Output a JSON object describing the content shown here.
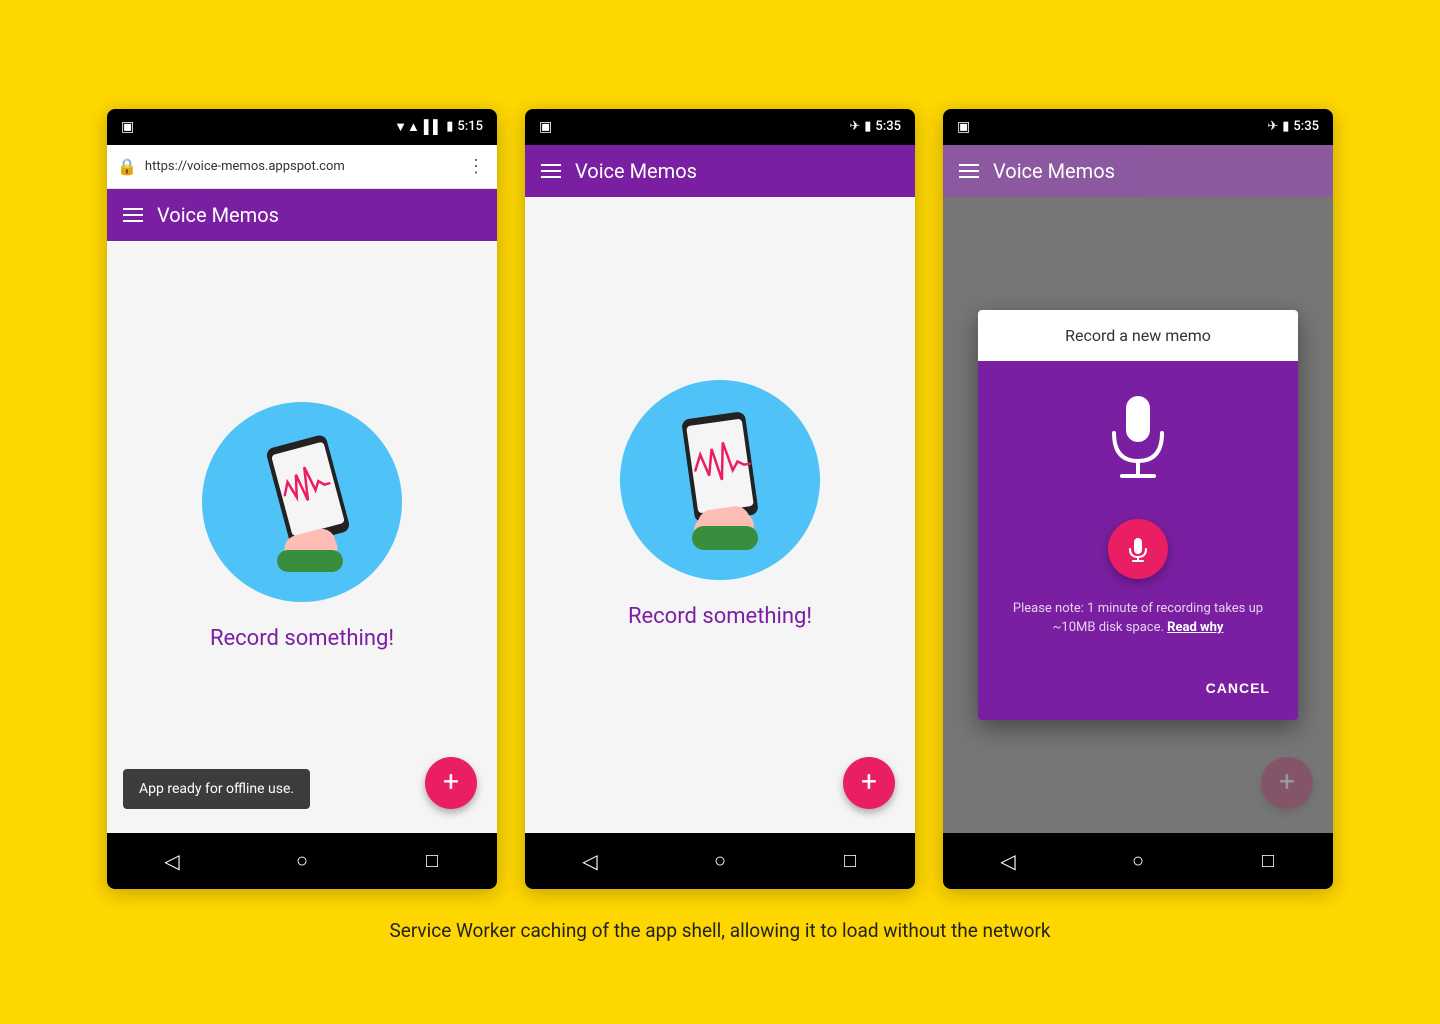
{
  "background": "#FFD700",
  "caption": "Service Worker caching of the app shell, allowing it to load without the network",
  "phone1": {
    "statusBar": {
      "signal": "▼▲",
      "bars": "▌▌",
      "battery": "🔋",
      "time": "5:15",
      "hasChrome": true
    },
    "chromeBar": {
      "url": "https://voice-memos.appspot.com",
      "hasLock": true
    },
    "appBar": {
      "title": "Voice Memos"
    },
    "content": {
      "recordLabel": "Record something!",
      "showSnackbar": true,
      "snackbarText": "App ready for offline use."
    },
    "fab": "+"
  },
  "phone2": {
    "statusBar": {
      "airplane": true,
      "battery": "🔋",
      "time": "5:35",
      "hasChrome": false
    },
    "appBar": {
      "title": "Voice Memos"
    },
    "content": {
      "recordLabel": "Record something!",
      "showSnackbar": false
    },
    "fab": "+"
  },
  "phone3": {
    "statusBar": {
      "airplane": true,
      "battery": "🔋",
      "time": "5:35",
      "hasChrome": false
    },
    "appBar": {
      "title": "Voice Memos"
    },
    "dialog": {
      "title": "Record a new memo",
      "note": "Please note: 1 minute of recording takes up ~10MB disk space.",
      "readWhy": "Read why",
      "cancelLabel": "CANCEL"
    },
    "fab": "+"
  },
  "navButtons": {
    "back": "◁",
    "home": "○",
    "recent": "□"
  }
}
